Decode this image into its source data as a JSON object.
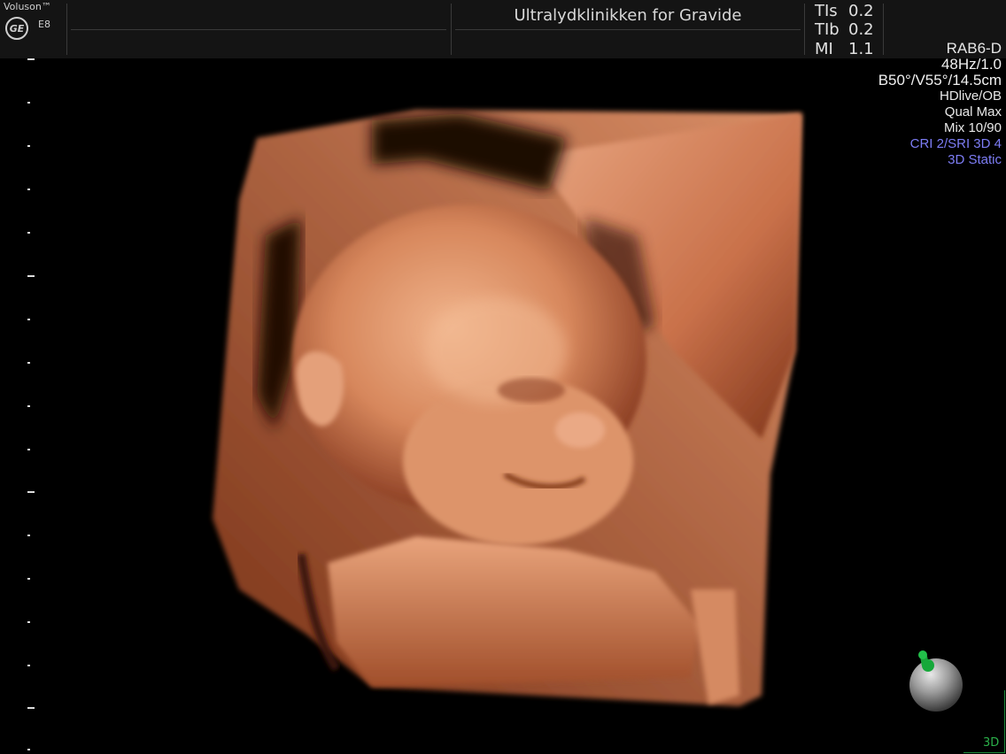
{
  "header": {
    "brand": "Voluson™",
    "logo_text": "GE",
    "model": "E8",
    "clinic_name": "Ultralydklinikken for Gravide"
  },
  "safety_indices": [
    {
      "label": "TIs",
      "value": "0.2"
    },
    {
      "label": "TIb",
      "value": "0.2"
    },
    {
      "label": "MI",
      "value": "1.1"
    }
  ],
  "params": {
    "probe": "RAB6-D",
    "frame_rate": "48Hz/1.0",
    "angles_depth": "B50°/V55°/14.5cm",
    "mode": "HDlive/OB",
    "quality": "Qual Max",
    "mix": "Mix 10/90",
    "cri_sri": "CRI 2/SRI 3D 4",
    "acquisition": "3D Static"
  },
  "colors": {
    "accent_blue": "#7d7df5",
    "orientation_green": "#2bb14a",
    "tissue": "#d9875d"
  },
  "icons": {
    "logo": "ge-logo-icon",
    "orientation": "orientation-sphere-icon"
  },
  "status": {
    "view_tag": "3D"
  }
}
